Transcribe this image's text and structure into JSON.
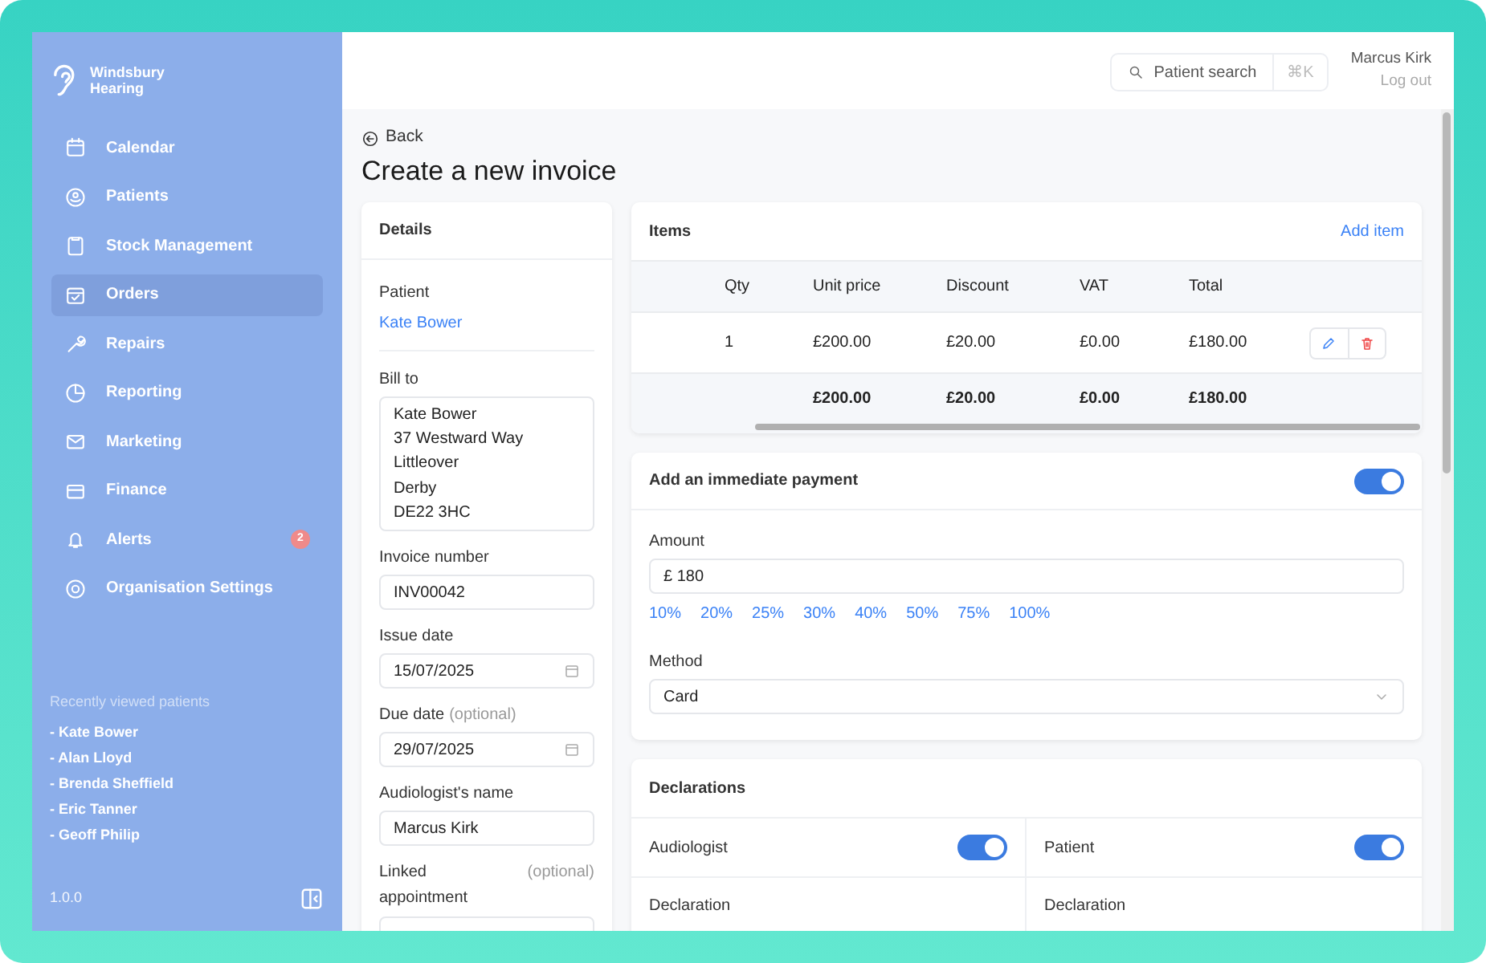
{
  "sidebar": {
    "brand": [
      "Windsbury",
      "Hearing"
    ],
    "nav": [
      {
        "label": "Calendar",
        "selected": false
      },
      {
        "label": "Patients",
        "selected": false
      },
      {
        "label": "Stock Management",
        "selected": false
      },
      {
        "label": "Orders",
        "selected": true
      },
      {
        "label": "Repairs",
        "selected": false
      },
      {
        "label": "Reporting",
        "selected": false
      },
      {
        "label": "Marketing",
        "selected": false
      },
      {
        "label": "Finance",
        "selected": false
      },
      {
        "label": "Alerts",
        "selected": false,
        "badge": "2"
      },
      {
        "label": "Organisation Settings",
        "selected": false
      }
    ],
    "recent_title": "Recently viewed patients",
    "recent": [
      "- Kate Bower",
      "- Alan Lloyd",
      "- Brenda Sheffield",
      "- Eric Tanner",
      "- Geoff Philip"
    ],
    "version": "1.0.0"
  },
  "header": {
    "search_placeholder": "Patient search",
    "shortcut": "⌘K",
    "user": "Marcus Kirk",
    "logout": "Log out"
  },
  "page": {
    "back": "Back",
    "title": "Create a new invoice"
  },
  "details": {
    "title": "Details",
    "patient_label": "Patient",
    "patient": "Kate Bower",
    "bill_to_label": "Bill to",
    "bill_to": [
      "Kate Bower",
      "37 Westward Way",
      "Littleover",
      "Derby",
      "DE22 3HC"
    ],
    "fields": [
      {
        "label": "Invoice number",
        "value": "INV00042",
        "kind": "text"
      },
      {
        "label": "Issue date",
        "value": "15/07/2025",
        "kind": "date"
      },
      {
        "label": "Due date",
        "optional": "(optional)",
        "value": "29/07/2025",
        "kind": "date"
      },
      {
        "label": "Audiologist's name",
        "value": "Marcus Kirk",
        "kind": "text"
      },
      {
        "label": "Linked appointment",
        "optional": "(optional)",
        "kind": "text"
      }
    ]
  },
  "items": {
    "title": "Items",
    "add": "Add item",
    "columns": [
      "Qty",
      "Unit price",
      "Discount",
      "VAT",
      "Total"
    ],
    "rows": [
      {
        "cells": [
          "1",
          "£200.00",
          "£20.00",
          "£0.00",
          "£180.00"
        ]
      }
    ],
    "totals": [
      "£200.00",
      "£20.00",
      "£0.00",
      "£180.00"
    ]
  },
  "payment": {
    "title": "Add an immediate payment",
    "on": true,
    "amount_label": "Amount",
    "amount": "£ 180",
    "percentages": [
      "10%",
      "20%",
      "25%",
      "30%",
      "40%",
      "50%",
      "75%",
      "100%"
    ],
    "method_label": "Method",
    "method": "Card"
  },
  "declarations": {
    "title": "Declarations",
    "parties": [
      {
        "label": "Audiologist",
        "on": true,
        "declaration_label": "Declaration"
      },
      {
        "label": "Patient",
        "on": true,
        "declaration_label": "Declaration"
      }
    ]
  }
}
